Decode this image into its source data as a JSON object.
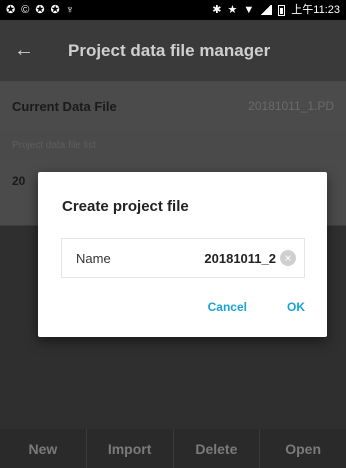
{
  "status_bar": {
    "time": "上午11:23",
    "left_icons": [
      "sync-icon",
      "sync-icon",
      "sync-icon",
      "sync-icon",
      "usb-icon"
    ],
    "right_icons": [
      "bluetooth-icon",
      "star-icon",
      "wifi-icon",
      "signal-icon",
      "battery-icon"
    ]
  },
  "appbar": {
    "title": "Project data file manager",
    "back_icon": "back-arrow-icon"
  },
  "current": {
    "label": "Current Data File",
    "value": "20181011_1.PD"
  },
  "list": {
    "header": "Project data file list",
    "first_item": "20"
  },
  "dialog": {
    "title": "Create project file",
    "name_label": "Name",
    "name_value": "20181011_2",
    "cancel": "Cancel",
    "ok": "OK",
    "accent_color": "#19a3d8"
  },
  "toolbar": {
    "new": "New",
    "import": "Import",
    "delete": "Delete",
    "open": "Open"
  }
}
